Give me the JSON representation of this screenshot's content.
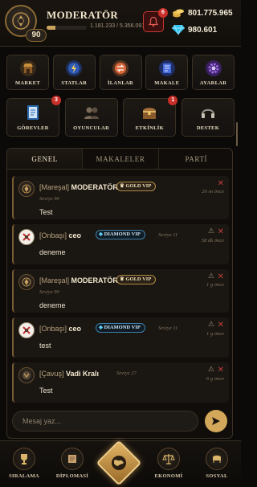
{
  "header": {
    "username": "MODERATÖR",
    "level": "90",
    "xp_text": "1.181.233 / 5.356.091",
    "xp_progress": 0.22,
    "notification_count": "6",
    "gold": "801.775.965",
    "diamonds": "980.601"
  },
  "menu": {
    "row1": [
      {
        "label": "MARKET",
        "icon": "market-icon"
      },
      {
        "label": "STATLAR",
        "icon": "stats-icon"
      },
      {
        "label": "İLANLAR",
        "icon": "ads-icon"
      },
      {
        "label": "MAKALE",
        "icon": "article-icon"
      },
      {
        "label": "AYARLAR",
        "icon": "settings-icon"
      }
    ],
    "row2": [
      {
        "label": "GÖREVLER",
        "icon": "quests-icon",
        "badge": "3"
      },
      {
        "label": "OYUNCULAR",
        "icon": "players-icon"
      },
      {
        "label": "ETKİNLİK",
        "icon": "event-icon",
        "badge": "1"
      },
      {
        "label": "DESTEK",
        "icon": "support-icon"
      }
    ]
  },
  "tabs": [
    "GENEL",
    "MAKALELER",
    "PARTİ"
  ],
  "active_tab": "GENEL",
  "messages": [
    {
      "rank": "[Mareşal]",
      "name": "MODERATÖR",
      "vip": "GOLD VIP",
      "level": "Seviye 90",
      "time": "20 sn önce",
      "text": "Test"
    },
    {
      "rank": "[Onbaşı]",
      "name": "ceo",
      "vip": "DIAMOND VIP",
      "level": "Seviye 11",
      "time": "58 dk önce",
      "text": "deneme"
    },
    {
      "rank": "[Mareşal]",
      "name": "MODERATÖR",
      "vip": "GOLD VIP",
      "level": "Seviye 90",
      "time": "1 g önce",
      "text": "deneme"
    },
    {
      "rank": "[Onbaşı]",
      "name": "ceo",
      "vip": "DIAMOND VIP",
      "level": "Seviye 11",
      "time": "1 g önce",
      "text": "test"
    },
    {
      "rank": "[Çavuş]",
      "name": "Vadi Kralı",
      "vip": "",
      "level": "Seviye 27",
      "time": "6 g önce",
      "text": "Test"
    }
  ],
  "input": {
    "placeholder": "Mesaj yaz..."
  },
  "bottom_nav": [
    {
      "label": "SIRALAMA",
      "icon": "trophy-icon"
    },
    {
      "label": "DİPLOMASİ",
      "icon": "scroll-icon"
    },
    {
      "label": "",
      "icon": "globe-icon"
    },
    {
      "label": "EKONOMİ",
      "icon": "scales-icon"
    },
    {
      "label": "SOSYAL",
      "icon": "social-icon"
    }
  ],
  "colors": {
    "accent_gold": "#d9b46a",
    "alert_red": "#c8302a",
    "diamond_blue": "#3f7fa8",
    "background": "#0c0a08"
  }
}
